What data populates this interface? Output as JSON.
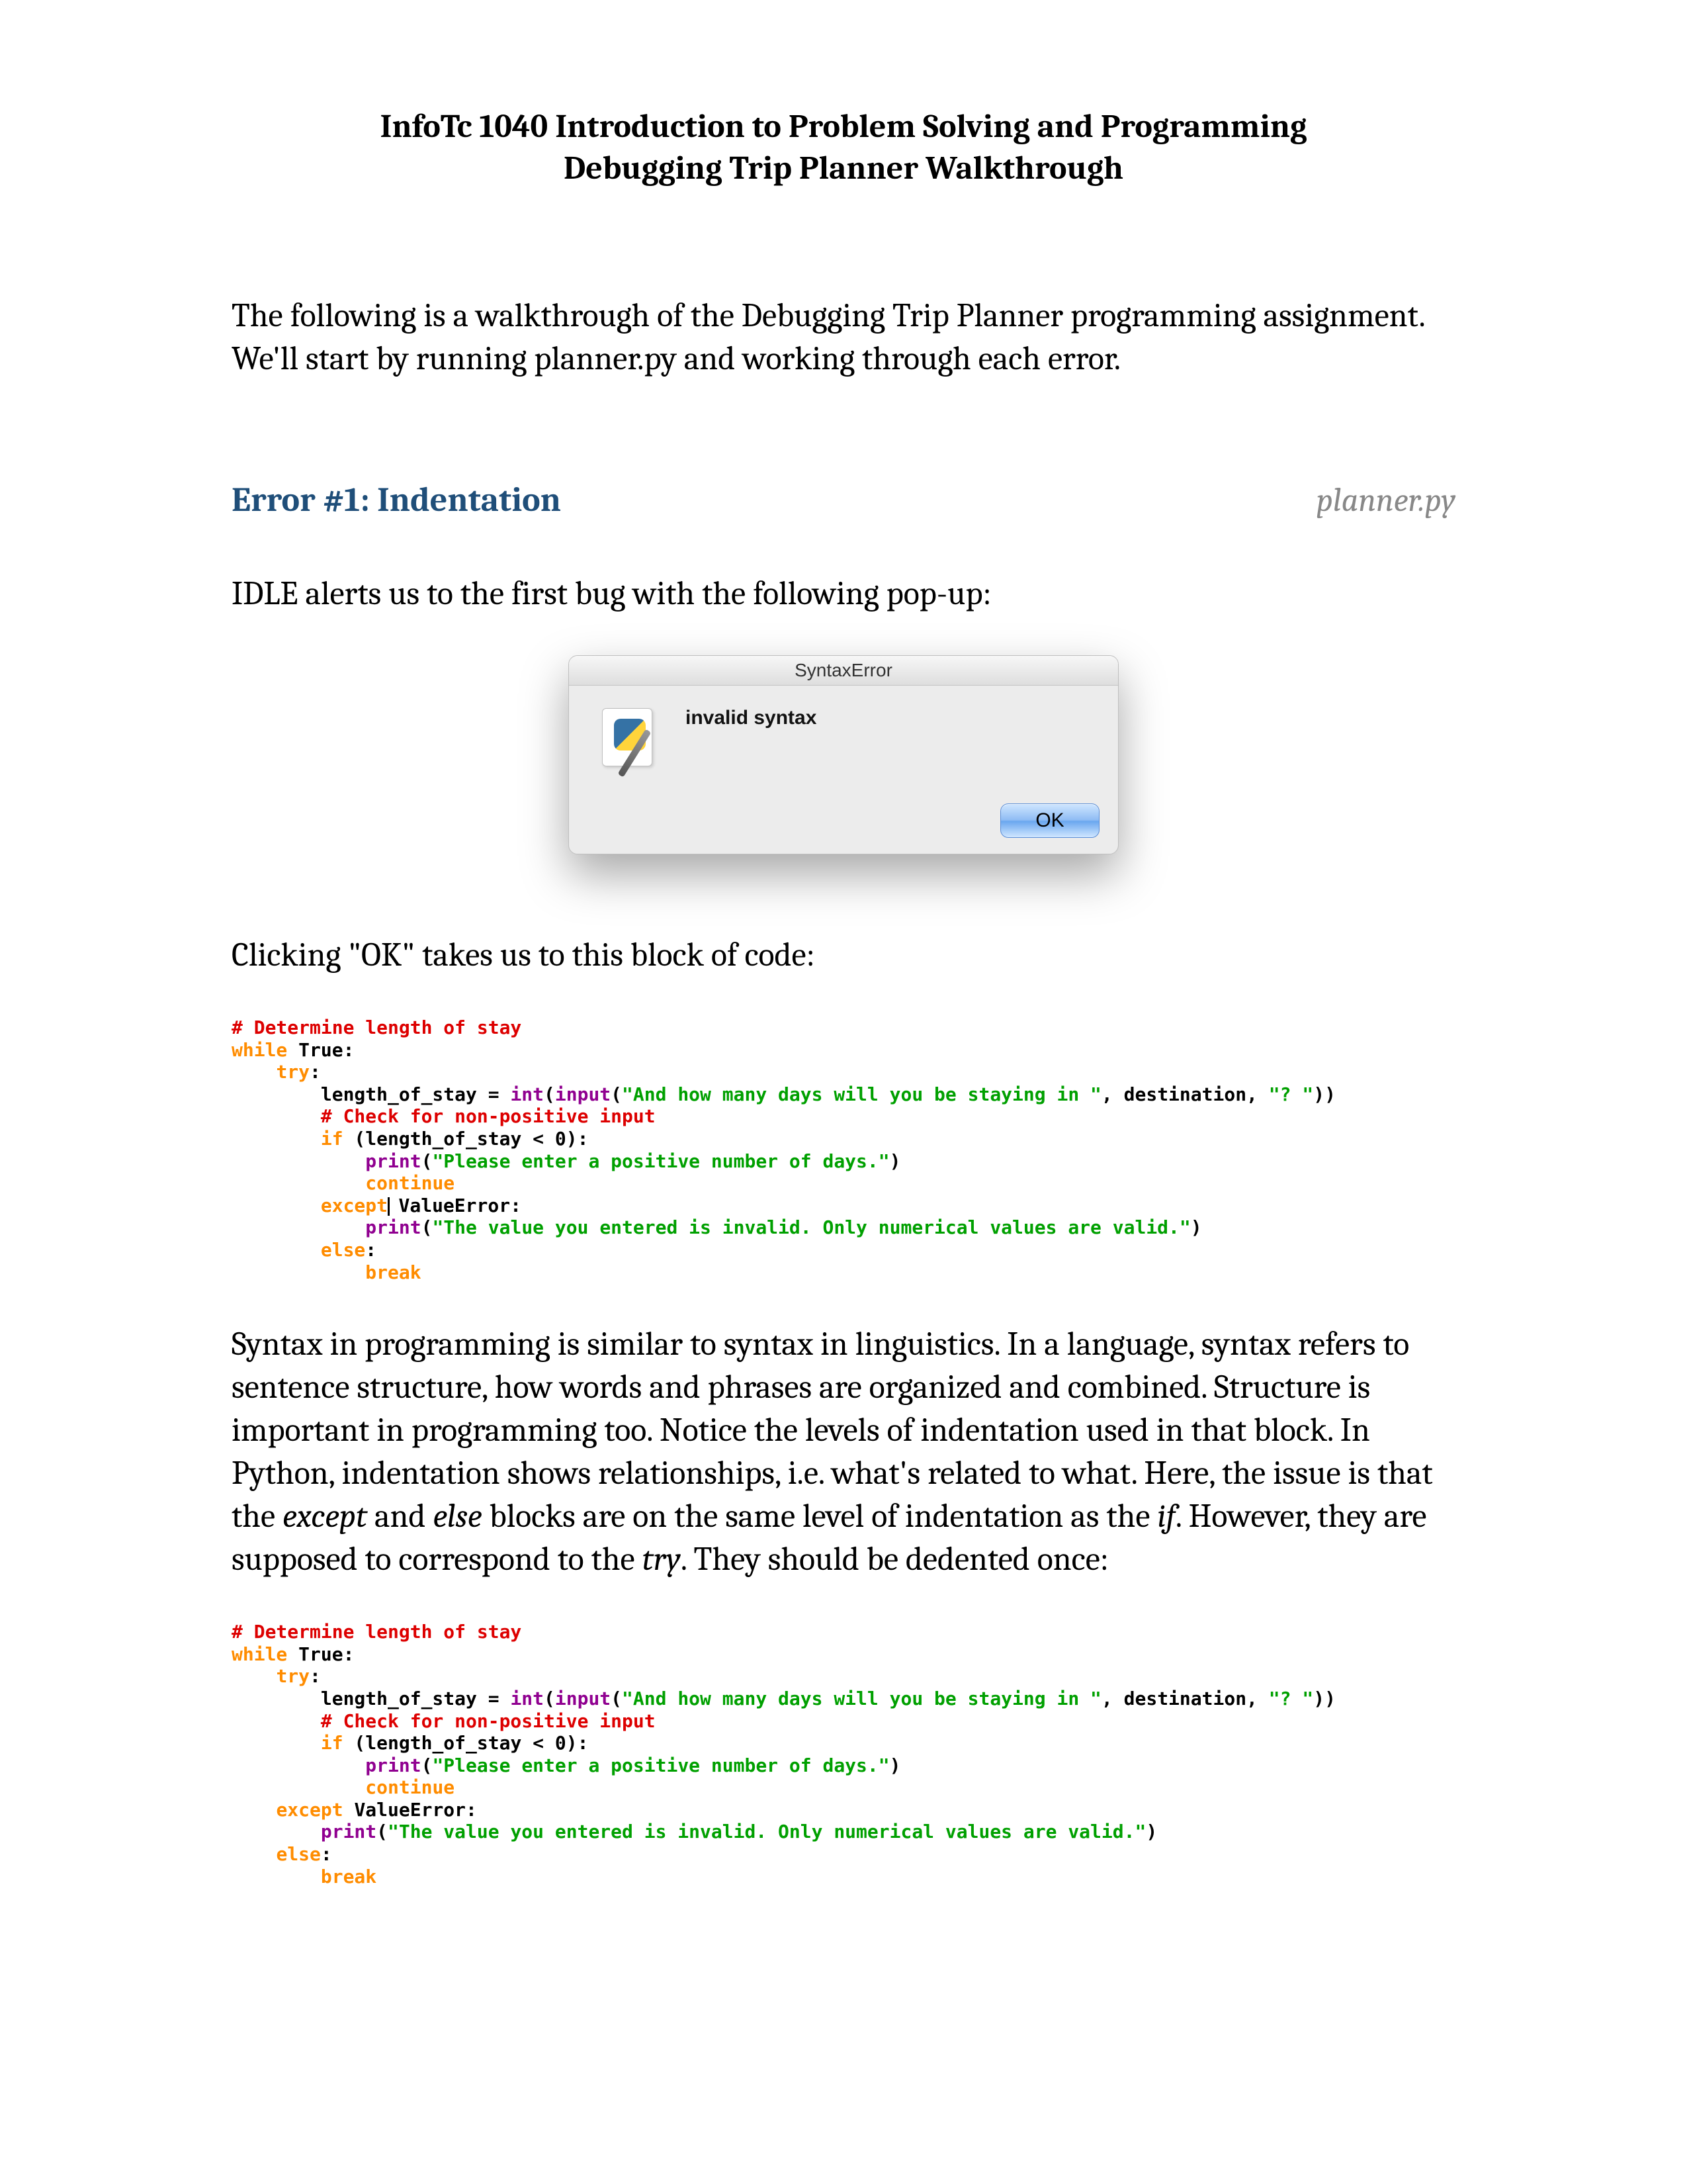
{
  "header": {
    "line1": "InfoTc 1040 Introduction to Problem Solving and Programming",
    "line2": "Debugging Trip Planner Walkthrough"
  },
  "intro": "The following is a walkthrough of the Debugging Trip Planner programming assignment. We'll start by running planner.py and working through each error.",
  "error1": {
    "title": "Error #1: Indentation",
    "file": "planner.py",
    "lead_in": "IDLE alerts us to the first bug with the following pop-up:",
    "after_dialog": "Clicking \"OK\" takes us to this block of code:",
    "explanation_parts": {
      "p1": "Syntax in programming is similar to syntax in linguistics. In a language, syntax refers to sentence structure, how words and phrases are organized and combined. Structure is important in programming too. Notice the levels of indentation used in that block. In Python, indentation shows relationships, i.e. what's related to what. Here, the issue is that the ",
      "em1": "except",
      "p2": " and ",
      "em2": "else",
      "p3": " blocks are on the same level of indentation as the ",
      "em3": "if",
      "p4": ". However, they are supposed to correspond to the ",
      "em4": "try",
      "p5": ". They should be dedented once:"
    }
  },
  "dialog": {
    "title": "SyntaxError",
    "message": "invalid syntax",
    "ok_label": "OK",
    "icon_name": "python-document-icon"
  },
  "code_block_1": {
    "c1": "# Determine length of stay",
    "kw_while": "while",
    "true": " True:",
    "kw_try": "try",
    "var_assign": "length_of_stay = ",
    "fn_int": "int",
    "paren1": "(",
    "fn_input": "input",
    "paren2": "(",
    "s1": "\"And how many days will you be staying in \"",
    "mid1": ", destination, ",
    "s2": "\"? \"",
    "close": "))",
    "c2": "# Check for non-positive input",
    "kw_if": "if",
    "cond": " (length_of_stay < 0):",
    "fn_print": "print",
    "s3": "\"Please enter a positive number of days.\"",
    "kw_continue": "continue",
    "kw_except": "except",
    "valerr": " ValueError:",
    "s4": "\"The value you entered is invalid. Only numerical values are valid.\"",
    "kw_else": "else",
    "colon": ":",
    "kw_break": "break"
  },
  "code_block_2": {
    "c1": "# Determine length of stay",
    "kw_while": "while",
    "true": " True:",
    "kw_try": "try",
    "var_assign": "length_of_stay = ",
    "fn_int": "int",
    "paren1": "(",
    "fn_input": "input",
    "paren2": "(",
    "s1": "\"And how many days will you be staying in \"",
    "mid1": ", destination, ",
    "s2": "\"? \"",
    "close": "))",
    "c2": "# Check for non-positive input",
    "kw_if": "if",
    "cond": " (length_of_stay < 0):",
    "fn_print": "print",
    "s3": "\"Please enter a positive number of days.\"",
    "kw_continue": "continue",
    "kw_except": "except",
    "valerr": " ValueError:",
    "s4": "\"The value you entered is invalid. Only numerical values are valid.\"",
    "kw_else": "else",
    "colon": ":",
    "kw_break": "break"
  }
}
